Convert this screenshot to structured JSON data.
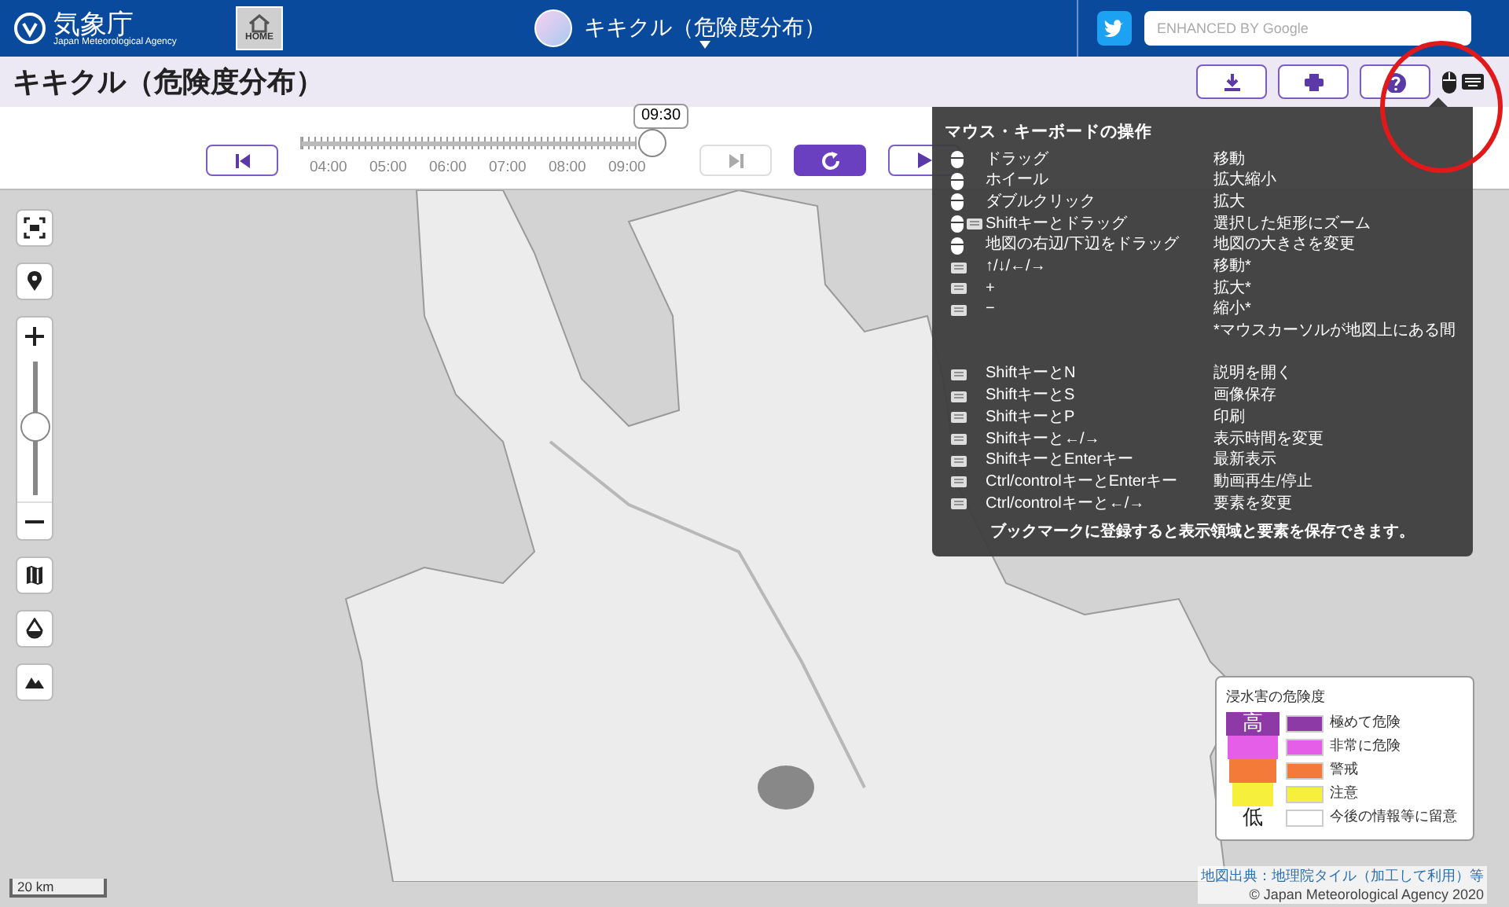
{
  "header": {
    "logo_text": "気象庁",
    "logo_subtext": "Japan Meteorological Agency",
    "home_label": "HOME",
    "app_title": "キキクル（危険度分布）",
    "search": {
      "placeholder": "ENHANCED BY Google"
    }
  },
  "title_bar": {
    "title": "キキクル（危険度分布）"
  },
  "timeline": {
    "current_time": "09:30",
    "level": 1.0,
    "ticks": [
      "04:00",
      "05:00",
      "06:00",
      "07:00",
      "08:00",
      "09:00"
    ],
    "next_disabled": true
  },
  "help_popup": {
    "title": "マウス・キーボードの操作",
    "rows": [
      {
        "kind": "mouse",
        "key": "ドラッグ",
        "action": "移動"
      },
      {
        "kind": "mouse",
        "key": "ホイール",
        "action": "拡大縮小"
      },
      {
        "kind": "mouse",
        "key": "ダブルクリック",
        "action": "拡大"
      },
      {
        "kind": "both",
        "key": "Shiftキーとドラッグ",
        "action": "選択した矩形にズーム"
      },
      {
        "kind": "mouse",
        "key": "地図の右辺/下辺をドラッグ",
        "action": "地図の大きさを変更"
      },
      {
        "kind": "keyboard",
        "key": "↑/↓/←/→",
        "action": "移動*"
      },
      {
        "kind": "keyboard",
        "key": "+",
        "action": "拡大*"
      },
      {
        "kind": "keyboard",
        "key": "−",
        "action": "縮小*"
      },
      {
        "kind": "note",
        "action": "*マウスカーソルが地図上にある間"
      },
      {
        "kind": "gap"
      },
      {
        "kind": "keyboard",
        "key": "ShiftキーとN",
        "action": "説明を開く"
      },
      {
        "kind": "keyboard",
        "key": "ShiftキーとS",
        "action": "画像保存"
      },
      {
        "kind": "keyboard",
        "key": "ShiftキーとP",
        "action": "印刷"
      },
      {
        "kind": "keyboard",
        "key": "Shiftキーと←/→",
        "action": "表示時間を変更"
      },
      {
        "kind": "keyboard",
        "key": "ShiftキーとEnterキー",
        "action": "最新表示"
      },
      {
        "kind": "keyboard",
        "key": "Ctrl/controlキーとEnterキー",
        "action": "動画再生/停止"
      },
      {
        "kind": "keyboard",
        "key": "Ctrl/controlキーと←/→",
        "action": "要素を変更"
      }
    ],
    "footer": "ブックマークに登録すると表示領域と要素を保存できます。"
  },
  "legend": {
    "title": "浸水害の危険度",
    "high": "高",
    "low": "低",
    "items": [
      {
        "label": "極めて危険",
        "color": "#8e3aa6"
      },
      {
        "label": "非常に危険",
        "color": "#e45ee8"
      },
      {
        "label": "警戒",
        "color": "#f47a3a"
      },
      {
        "label": "注意",
        "color": "#f6ef3c"
      },
      {
        "label": "今後の情報等に留意",
        "color": "#ffffff"
      }
    ]
  },
  "scale": "20 km",
  "attribution": {
    "source": "地図出典：地理院タイル（加工して利用）等",
    "copyright": "© Japan Meteorological Agency 2020"
  }
}
